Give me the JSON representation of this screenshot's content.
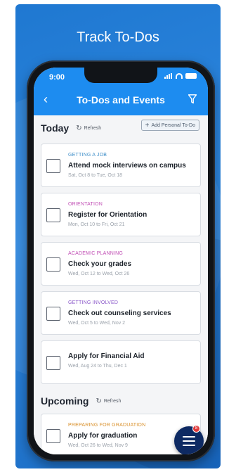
{
  "headline": "Track To-Dos",
  "status": {
    "time": "9:00"
  },
  "nav": {
    "back": "‹",
    "title": "To-Dos and Events"
  },
  "today": {
    "title": "Today",
    "refresh_label": "Refresh",
    "add_label": "Add Personal To-Do",
    "items": [
      {
        "category": "GETTING A JOB",
        "category_color": "#3f8fc9",
        "title": "Attend mock interviews on campus",
        "dates": "Sat, Oct 8 to Tue, Oct 18"
      },
      {
        "category": "ORIENTATION",
        "category_color": "#c14fb5",
        "title": "Register for Orientation",
        "dates": "Mon, Oct 10 to Fri, Oct 21"
      },
      {
        "category": "ACADEMIC PLANNING",
        "category_color": "#c14fb5",
        "title": "Check your grades",
        "dates": "Wed, Oct 12 to Wed, Oct 26"
      },
      {
        "category": "GETTING INVOLVED",
        "category_color": "#8a57c9",
        "title": "Check out counseling services",
        "dates": "Wed, Oct 5 to Wed, Nov 2"
      },
      {
        "category": "",
        "category_color": "#3f8fc9",
        "title": "Apply for Financial Aid",
        "dates": "Wed, Aug 24 to Thu, Dec 1"
      }
    ]
  },
  "upcoming": {
    "title": "Upcoming",
    "refresh_label": "Refresh",
    "items": [
      {
        "category": "PREPARING FOR GRADUATION",
        "category_color": "#d9902a",
        "title": "Apply for graduation",
        "dates": "Wed, Oct 26 to Wed, Nov 9"
      }
    ]
  },
  "fab": {
    "badge": "8"
  },
  "colors": {
    "primary": "#1d8cf0",
    "fab": "#0e2a63",
    "badge": "#e03a3a"
  }
}
